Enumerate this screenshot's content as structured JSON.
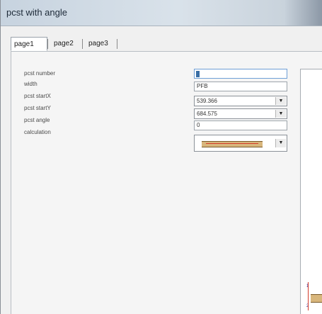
{
  "window": {
    "title": "pcst with angle"
  },
  "tabs": [
    {
      "label": "page1",
      "active": true
    },
    {
      "label": "page2",
      "active": false
    },
    {
      "label": "page3",
      "active": false
    }
  ],
  "form": {
    "pcst_number": {
      "label": "pcst number",
      "value": ""
    },
    "width": {
      "label": "width",
      "value": "PFB"
    },
    "pcst_start_x": {
      "label": "pcst startX",
      "value": "539.366"
    },
    "pcst_start_y": {
      "label": "pcst startY",
      "value": "684.575"
    },
    "pcst_angle": {
      "label": "pcst angle",
      "value": "0"
    },
    "calculation": {
      "label": "calculation"
    }
  },
  "preview": {
    "axis_labels": [
      "1",
      "2"
    ]
  },
  "colors": {
    "beam_fill": "#d8b67c",
    "beam_edge": "#7a5a2a",
    "accent_red": "#d43b2b"
  },
  "icons": {
    "dropdown": "chevron-down-icon"
  }
}
